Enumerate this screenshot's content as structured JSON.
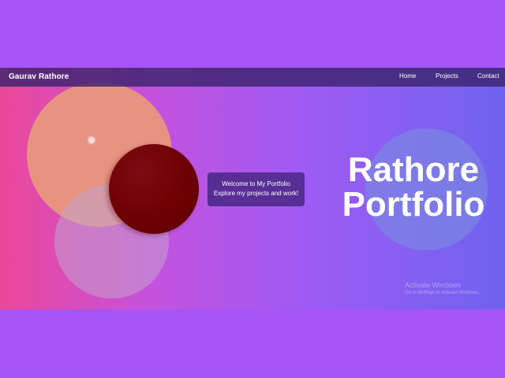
{
  "navbar": {
    "brand": "Gaurav Rathore",
    "links": [
      "Home",
      "Projects",
      "Contact"
    ]
  },
  "welcome": {
    "line1": "Welcome to My Portfolio",
    "line2": "Explore my projects and work!"
  },
  "hero": {
    "line1": "Rathore",
    "line2": "Portfolio"
  },
  "watermark": {
    "title": "Activate Windows",
    "subtitle": "Go to Settings to activate Windows."
  },
  "colors": {
    "outer_background": "#a855f7",
    "gradient_start": "#ec4899",
    "gradient_end": "#6f63ef",
    "navbar": "#3c236e",
    "dark_circle": "#6e0000",
    "peach_circle": "#e8977e"
  }
}
